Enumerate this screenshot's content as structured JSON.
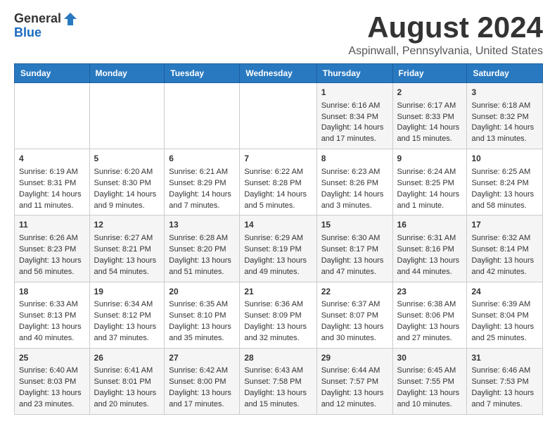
{
  "logo": {
    "general": "General",
    "blue": "Blue"
  },
  "title": "August 2024",
  "location": "Aspinwall, Pennsylvania, United States",
  "days_of_week": [
    "Sunday",
    "Monday",
    "Tuesday",
    "Wednesday",
    "Thursday",
    "Friday",
    "Saturday"
  ],
  "weeks": [
    [
      {
        "day": "",
        "content": ""
      },
      {
        "day": "",
        "content": ""
      },
      {
        "day": "",
        "content": ""
      },
      {
        "day": "",
        "content": ""
      },
      {
        "day": "1",
        "content": "Sunrise: 6:16 AM\nSunset: 8:34 PM\nDaylight: 14 hours\nand 17 minutes."
      },
      {
        "day": "2",
        "content": "Sunrise: 6:17 AM\nSunset: 8:33 PM\nDaylight: 14 hours\nand 15 minutes."
      },
      {
        "day": "3",
        "content": "Sunrise: 6:18 AM\nSunset: 8:32 PM\nDaylight: 14 hours\nand 13 minutes."
      }
    ],
    [
      {
        "day": "4",
        "content": "Sunrise: 6:19 AM\nSunset: 8:31 PM\nDaylight: 14 hours\nand 11 minutes."
      },
      {
        "day": "5",
        "content": "Sunrise: 6:20 AM\nSunset: 8:30 PM\nDaylight: 14 hours\nand 9 minutes."
      },
      {
        "day": "6",
        "content": "Sunrise: 6:21 AM\nSunset: 8:29 PM\nDaylight: 14 hours\nand 7 minutes."
      },
      {
        "day": "7",
        "content": "Sunrise: 6:22 AM\nSunset: 8:28 PM\nDaylight: 14 hours\nand 5 minutes."
      },
      {
        "day": "8",
        "content": "Sunrise: 6:23 AM\nSunset: 8:26 PM\nDaylight: 14 hours\nand 3 minutes."
      },
      {
        "day": "9",
        "content": "Sunrise: 6:24 AM\nSunset: 8:25 PM\nDaylight: 14 hours\nand 1 minute."
      },
      {
        "day": "10",
        "content": "Sunrise: 6:25 AM\nSunset: 8:24 PM\nDaylight: 13 hours\nand 58 minutes."
      }
    ],
    [
      {
        "day": "11",
        "content": "Sunrise: 6:26 AM\nSunset: 8:23 PM\nDaylight: 13 hours\nand 56 minutes."
      },
      {
        "day": "12",
        "content": "Sunrise: 6:27 AM\nSunset: 8:21 PM\nDaylight: 13 hours\nand 54 minutes."
      },
      {
        "day": "13",
        "content": "Sunrise: 6:28 AM\nSunset: 8:20 PM\nDaylight: 13 hours\nand 51 minutes."
      },
      {
        "day": "14",
        "content": "Sunrise: 6:29 AM\nSunset: 8:19 PM\nDaylight: 13 hours\nand 49 minutes."
      },
      {
        "day": "15",
        "content": "Sunrise: 6:30 AM\nSunset: 8:17 PM\nDaylight: 13 hours\nand 47 minutes."
      },
      {
        "day": "16",
        "content": "Sunrise: 6:31 AM\nSunset: 8:16 PM\nDaylight: 13 hours\nand 44 minutes."
      },
      {
        "day": "17",
        "content": "Sunrise: 6:32 AM\nSunset: 8:14 PM\nDaylight: 13 hours\nand 42 minutes."
      }
    ],
    [
      {
        "day": "18",
        "content": "Sunrise: 6:33 AM\nSunset: 8:13 PM\nDaylight: 13 hours\nand 40 minutes."
      },
      {
        "day": "19",
        "content": "Sunrise: 6:34 AM\nSunset: 8:12 PM\nDaylight: 13 hours\nand 37 minutes."
      },
      {
        "day": "20",
        "content": "Sunrise: 6:35 AM\nSunset: 8:10 PM\nDaylight: 13 hours\nand 35 minutes."
      },
      {
        "day": "21",
        "content": "Sunrise: 6:36 AM\nSunset: 8:09 PM\nDaylight: 13 hours\nand 32 minutes."
      },
      {
        "day": "22",
        "content": "Sunrise: 6:37 AM\nSunset: 8:07 PM\nDaylight: 13 hours\nand 30 minutes."
      },
      {
        "day": "23",
        "content": "Sunrise: 6:38 AM\nSunset: 8:06 PM\nDaylight: 13 hours\nand 27 minutes."
      },
      {
        "day": "24",
        "content": "Sunrise: 6:39 AM\nSunset: 8:04 PM\nDaylight: 13 hours\nand 25 minutes."
      }
    ],
    [
      {
        "day": "25",
        "content": "Sunrise: 6:40 AM\nSunset: 8:03 PM\nDaylight: 13 hours\nand 23 minutes."
      },
      {
        "day": "26",
        "content": "Sunrise: 6:41 AM\nSunset: 8:01 PM\nDaylight: 13 hours\nand 20 minutes."
      },
      {
        "day": "27",
        "content": "Sunrise: 6:42 AM\nSunset: 8:00 PM\nDaylight: 13 hours\nand 17 minutes."
      },
      {
        "day": "28",
        "content": "Sunrise: 6:43 AM\nSunset: 7:58 PM\nDaylight: 13 hours\nand 15 minutes."
      },
      {
        "day": "29",
        "content": "Sunrise: 6:44 AM\nSunset: 7:57 PM\nDaylight: 13 hours\nand 12 minutes."
      },
      {
        "day": "30",
        "content": "Sunrise: 6:45 AM\nSunset: 7:55 PM\nDaylight: 13 hours\nand 10 minutes."
      },
      {
        "day": "31",
        "content": "Sunrise: 6:46 AM\nSunset: 7:53 PM\nDaylight: 13 hours\nand 7 minutes."
      }
    ]
  ]
}
